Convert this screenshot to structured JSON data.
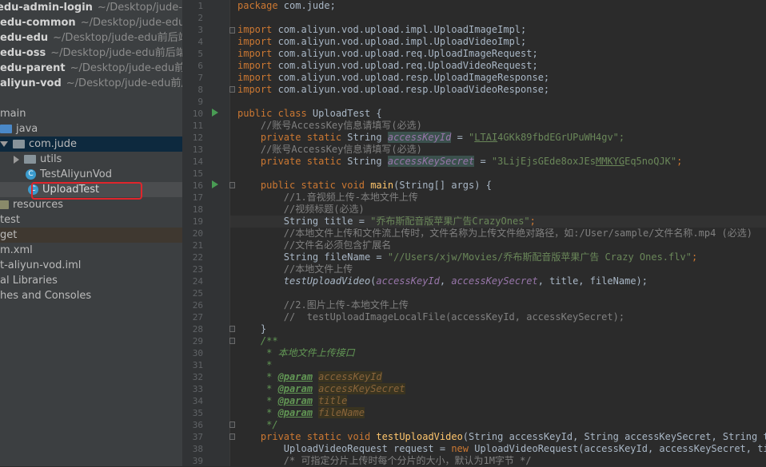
{
  "sidebar": {
    "modules": [
      {
        "name": "edu-admin-login",
        "path": "~/Desktop/jude-edu"
      },
      {
        "name": "edu-common",
        "path": "~/Desktop/jude-edu前后"
      },
      {
        "name": "edu-edu",
        "path": "~/Desktop/jude-edu前后端分"
      },
      {
        "name": "edu-oss",
        "path": "~/Desktop/jude-edu前后端分"
      },
      {
        "name": "edu-parent",
        "path": "~/Desktop/jude-edu前后端"
      },
      {
        "name": "aliyun-vod",
        "path": "~/Desktop/jude-edu前后端"
      }
    ],
    "tree": {
      "main": "main",
      "java": "java",
      "com_jude": "com.jude",
      "utils": "utils",
      "test_aliyun_vod": "TestAliyunVod",
      "upload_test": "UploadTest",
      "resources": "resources",
      "test": "test",
      "target": "get",
      "pom": "m.xml",
      "iml": "t-aliyun-vod.iml",
      "ext_libs": "al Libraries",
      "scratches": "hes and Consoles"
    }
  },
  "editor": {
    "line_numbers": [
      "1",
      "2",
      "3",
      "4",
      "5",
      "6",
      "7",
      "8",
      "9",
      "10",
      "11",
      "12",
      "13",
      "14",
      "15",
      "16",
      "17",
      "18",
      "19",
      "20",
      "21",
      "22",
      "23",
      "24",
      "25",
      "26",
      "27",
      "28",
      "29",
      "30",
      "31",
      "32",
      "33",
      "34",
      "35",
      "36",
      "37",
      "38",
      "39"
    ],
    "l1": {
      "kw": "package",
      "rest": " com.jude;"
    },
    "imports": [
      " com.aliyun.vod.upload.impl.UploadImageImpl;",
      " com.aliyun.vod.upload.impl.UploadVideoImpl;",
      " com.aliyun.vod.upload.req.UploadImageRequest;",
      " com.aliyun.vod.upload.req.UploadVideoRequest;",
      " com.aliyun.vod.upload.resp.UploadImageResponse;",
      " com.aliyun.vod.upload.resp.UploadVideoResponse;"
    ],
    "import_kw": "import",
    "l10": {
      "kw": "public class",
      "rest": " UploadTest {"
    },
    "l11": "    //账号AccessKey信息请填写(必选)",
    "l12": {
      "ind": "    ",
      "kw": "private static",
      "type": " String ",
      "fld": "accessKeyId",
      "eq": " = ",
      "q": "\"",
      "val1": "LTAI",
      "val2": "4GKk89fbdEGrUPuWH4gv",
      "end": "\";"
    },
    "l13": "    //账号AccessKey信息请填写(必选)",
    "l14": {
      "ind": "    ",
      "kw": "private static",
      "type": " String ",
      "fld": "accessKeySecret",
      "eq": " = ",
      "v1": "\"3LijEjsGEde8oxJEs",
      "v2": "MMKYG",
      "v3": "Eq5noQJK\"",
      "end": ";"
    },
    "l16": {
      "ind": "    ",
      "kw": "public static void",
      "sp": " ",
      "mth": "main",
      "rest": "(String[] args) {"
    },
    "l17": "        //1.音视频上传-本地文件上传",
    "l18": "        //视频标题(必选)",
    "l19": {
      "a": "        String title = ",
      "s": "\"乔布斯配音版苹果广告CrazyOnes\"",
      "b": ";"
    },
    "l20": "        //本地文件上传和文件流上传时，文件名称为上传文件绝对路径，如:/User/sample/文件名称.mp4 (必选)",
    "l21": "        //文件名必须包含扩展名",
    "l22": {
      "a": "        String fileName = ",
      "s": "\"//Users/xjw/Movies/乔布斯配音版苹果广告 Crazy Ones.flv\"",
      "b": ";"
    },
    "l23": "        //本地文件上传",
    "l24": {
      "ind": "        ",
      "m": "testUploadVideo",
      "p": "(",
      "f1": "accessKeyId",
      "c": ", ",
      "f2": "accessKeySecret",
      "rest": ", title, fileName);"
    },
    "l26": "        //2.图片上传-本地文件上传",
    "l27": "        //  testUploadImageLocalFile(accessKeyId, accessKeySecret);",
    "l28": "    }",
    "l29": "    /**",
    "l30": "     * 本地文件上传接口",
    "l31": "     *",
    "doc_prefix": "     * ",
    "doc_tag": "@param",
    "doc_params": [
      "accessKeyId",
      "accessKeySecret",
      "title",
      "fileName"
    ],
    "l36": "     */",
    "l37": {
      "ind": "    ",
      "kw": "private static void",
      "sp": " ",
      "mth": "testUploadVideo",
      "rest": "(String accessKeyId, String accessKeySecret, String titl"
    },
    "l38": {
      "a": "        UploadVideoRequest request = ",
      "kw": "new",
      "b": " UploadVideoRequest(accessKeyId, accessKeySecret, title"
    },
    "l39": "        /* 可指定分片上传时每个分片的大小，默认为1M字节 */"
  }
}
